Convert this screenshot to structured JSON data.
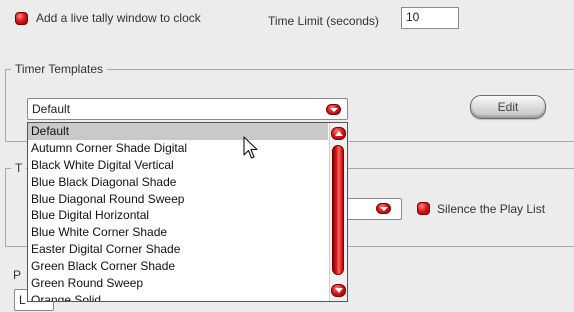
{
  "live_tally": {
    "label": "Add a live tally window to clock",
    "checked": true
  },
  "time_limit": {
    "label": "Time Limit (seconds)",
    "value": "10"
  },
  "timer_templates": {
    "group_label": "Timer Templates",
    "selected": "Default",
    "edit_label": "Edit"
  },
  "dropdown": {
    "items": [
      "Default",
      "Autumn Corner Shade Digital",
      "Black White Digital Vertical",
      "Blue Black Diagonal Shade",
      "Blue Diagonal Round Sweep",
      "Blue Digital Horizontal",
      "Blue White Corner Shade",
      "Easter Digital Corner Shade",
      "Green Black Corner Shade",
      "Green Round Sweep",
      "Orange Solid"
    ],
    "highlighted_index": 0
  },
  "partial": {
    "group2_initial": "T",
    "label3_initial": "P",
    "combo3_initial": "L"
  },
  "silence_play_list": {
    "label": "Silence the Play List",
    "checked": true
  },
  "colors": {
    "accent_red": "#d51616",
    "background": "#ececec"
  }
}
